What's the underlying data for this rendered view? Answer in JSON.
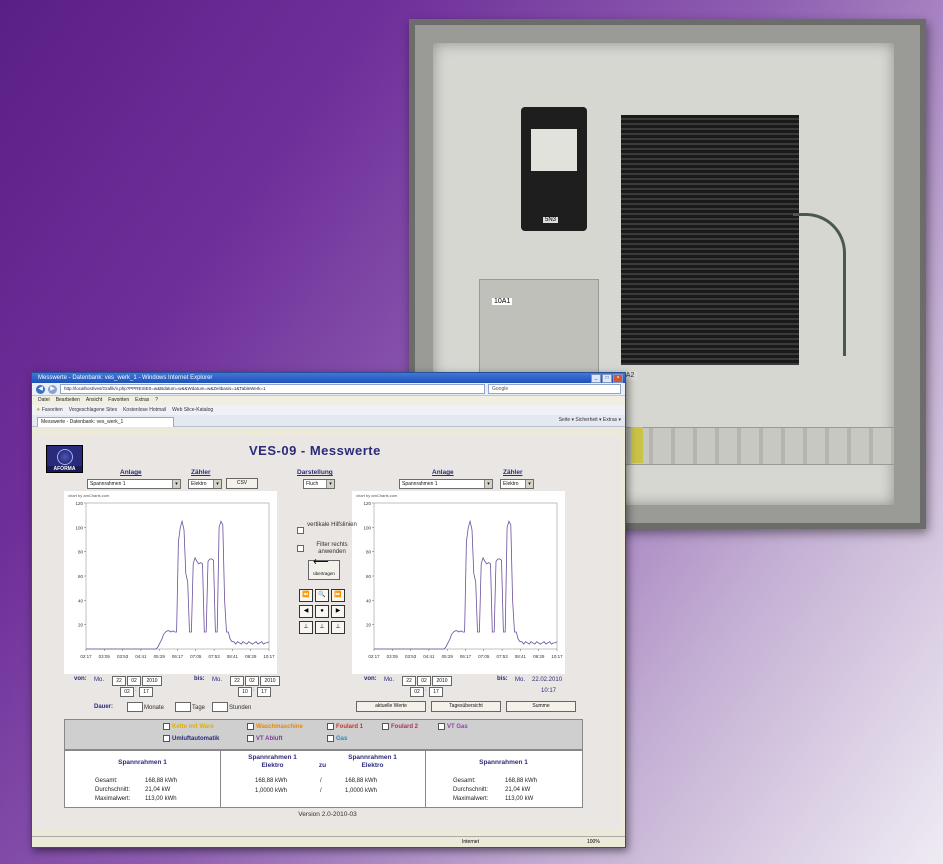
{
  "colors": {
    "accent": "#2b2b7a",
    "plot_line": "#6a4f9e",
    "background_start": "#5a1f86"
  },
  "photo": {
    "psu_label": "5N3",
    "plc_label": "10A1",
    "pc_label": "10A2"
  },
  "browser": {
    "window_title": "Messwerte - Datenbank: ves_werk_1 - Windows Internet Explorer",
    "address": "http://localhost/ves/Grafik/x.php?PPREISE0=w&Bdatum=w&&Wdatum=w&Zeitbasis=1&TableWerk=1",
    "search_placeholder": "Google",
    "menu": [
      "Datei",
      "Bearbeiten",
      "Ansicht",
      "Favoriten",
      "Extras",
      "?"
    ],
    "favorites": [
      "Favoriten",
      "Vorgeschlagene Sites",
      "Kostenlose Hotmail",
      "Web Slice-Katalog"
    ],
    "tab_label": "Messwerte - Datenbank: ves_werk_1",
    "tab_tools": "Seite ▾  Sicherheit ▾  Extras ▾",
    "status": "Internet",
    "zoom": "100%"
  },
  "page": {
    "logo_text": "AFORMA",
    "title": "VES-09   -   Messwerte",
    "left": {
      "anlage_label": "Anlage",
      "anlage_value": "Spannrahmen 1",
      "zaehler_label": "Zähler",
      "zaehler_value": "Elektro",
      "csv_label": "CSV"
    },
    "darstellung": {
      "label": "Darstellung",
      "value": "Fluch"
    },
    "right": {
      "anlage_label": "Anlage",
      "anlage_value": "Spannrahmen 1",
      "zaehler_label": "Zähler",
      "zaehler_value": "Elektro"
    },
    "options": {
      "hilfslinien": "vertikale Hilfslinien",
      "filter": "Filter rechts anwenden",
      "uebertragen": "übertragen"
    },
    "controls": {
      "row1": [
        "⏪",
        "🔍",
        "⏩"
      ],
      "row2": [
        "◀",
        "●",
        "▶"
      ],
      "row3": [
        "⊥",
        "⊥",
        "⊥"
      ]
    },
    "left_range": {
      "von_label": "von:",
      "von_day": "Mo.",
      "von_d": "22",
      "von_m": "02",
      "von_y": "2010",
      "von_h": "02",
      "von_min": "17",
      "bis_label": "bis:",
      "bis_day": "Mo.",
      "bis_d": "22",
      "bis_m": "02",
      "bis_y": "2010",
      "bis_h": "10",
      "bis_min": "17"
    },
    "right_range": {
      "von_label": "von:",
      "von_day": "Mo.",
      "von_d": "22",
      "von_m": "02",
      "von_y": "2010",
      "von_h": "02",
      "von_min": "17",
      "bis_label": "bis:",
      "bis_day": "Mo.",
      "bis_date": "22.02.2010",
      "bis_time": "10:17"
    },
    "dauer": {
      "label": "Dauer:",
      "monate": "Monate",
      "tage": "Tage",
      "stunden": "Stunden"
    },
    "buttons": {
      "aktuell": "aktuelle Werte",
      "tagesuebersicht": "Tagesübersicht",
      "summe": "Summe"
    },
    "legend": [
      {
        "label": "Kette mit Ware",
        "color": "#e0b000"
      },
      {
        "label": "Waschmaschine",
        "color": "#e58a00"
      },
      {
        "label": "Foulard 1",
        "color": "#c0392b"
      },
      {
        "label": "Foulard 2",
        "color": "#b03060"
      },
      {
        "label": "VT Gas",
        "color": "#8e44ad"
      },
      {
        "label": "Umluftautomatik",
        "color": "#2b2b7a"
      },
      {
        "label": "VT Abluft",
        "color": "#7d3c98"
      },
      {
        "label": "Gas",
        "color": "#2e86c1"
      }
    ],
    "summary": {
      "left": {
        "title": "Spannrahmen 1",
        "rows": [
          [
            "Gesamt:",
            "168,88 kWh"
          ],
          [
            "Durchschnitt:",
            "21,04 kW"
          ],
          [
            "Maximalwert:",
            "113,00 kWh"
          ]
        ]
      },
      "middle": {
        "title_a": "Spannrahmen 1",
        "title_a2": "Elektro",
        "zu": "zu",
        "title_b": "Spannrahmen 1",
        "title_b2": "Elektro",
        "rows": [
          [
            "168,88 kWh",
            "/",
            "168,88 kWh"
          ],
          [
            "1,0000 kWh",
            "/",
            "1,0000 kWh"
          ]
        ]
      },
      "right": {
        "title": "Spannrahmen 1",
        "rows": [
          [
            "Gesamt:",
            "168,88 kWh"
          ],
          [
            "Durchschnitt:",
            "21,04 kW"
          ],
          [
            "Maximalwert:",
            "113,00 kW"
          ]
        ]
      }
    },
    "version": "Version 2.0-2010-03"
  },
  "chart_data": [
    {
      "type": "line",
      "credit": "chart by amCharts.com",
      "x_ticks": [
        "02:17",
        "03:05",
        "03:53",
        "04:41",
        "05:29",
        "06:17",
        "07:05",
        "07:53",
        "08:41",
        "09:29",
        "10:17"
      ],
      "y_ticks": [
        "120",
        "100",
        "80",
        "60",
        "40",
        "20"
      ],
      "ylim": [
        0,
        120
      ],
      "values": [
        0,
        0,
        0,
        0,
        0,
        0,
        0,
        0,
        0,
        0,
        0,
        0,
        0,
        0,
        0,
        0,
        0,
        0,
        0,
        0,
        0,
        0,
        0,
        0,
        0,
        0,
        0,
        0,
        0,
        0,
        0,
        0,
        0,
        0,
        0,
        0,
        0,
        0,
        0,
        2,
        5,
        8,
        12,
        14,
        15,
        15,
        14,
        15,
        14,
        14,
        88,
        100,
        105,
        98,
        62,
        55,
        14,
        14,
        70,
        75,
        72,
        70,
        71,
        70,
        14,
        14,
        72,
        74,
        74,
        73,
        14,
        14,
        100,
        105,
        102,
        40,
        14,
        14,
        8,
        6,
        6,
        4,
        6,
        5,
        4,
        6,
        5,
        4,
        6,
        5,
        4,
        5,
        6,
        4,
        5,
        6,
        4,
        5,
        5,
        6
      ]
    },
    {
      "type": "line",
      "credit": "chart by amCharts.com",
      "x_ticks": [
        "02:17",
        "03:05",
        "03:53",
        "04:41",
        "05:29",
        "06:17",
        "07:05",
        "07:53",
        "08:41",
        "09:29",
        "10:17"
      ],
      "y_ticks": [
        "120",
        "100",
        "80",
        "60",
        "40",
        "20"
      ],
      "ylim": [
        0,
        120
      ],
      "values": [
        0,
        0,
        0,
        0,
        0,
        0,
        0,
        0,
        0,
        0,
        0,
        0,
        0,
        0,
        0,
        0,
        0,
        0,
        0,
        0,
        0,
        0,
        0,
        0,
        0,
        0,
        0,
        0,
        0,
        0,
        0,
        0,
        0,
        0,
        0,
        0,
        0,
        0,
        0,
        2,
        5,
        8,
        12,
        14,
        15,
        15,
        14,
        15,
        14,
        14,
        88,
        100,
        105,
        98,
        62,
        55,
        14,
        14,
        70,
        75,
        72,
        70,
        71,
        70,
        14,
        14,
        72,
        74,
        74,
        73,
        14,
        14,
        100,
        105,
        102,
        40,
        14,
        14,
        8,
        6,
        6,
        4,
        6,
        5,
        4,
        6,
        5,
        4,
        6,
        5,
        4,
        5,
        6,
        4,
        5,
        6,
        4,
        5,
        5,
        6
      ]
    }
  ]
}
